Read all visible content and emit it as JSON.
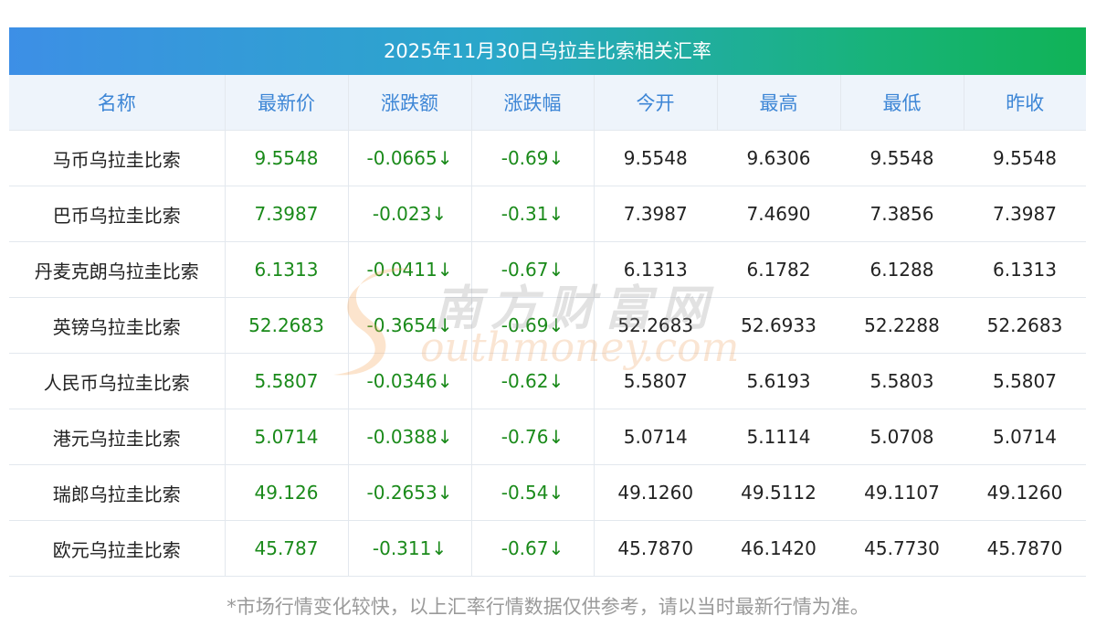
{
  "title": "2025年11月30日乌拉圭比索相关汇率",
  "headers": [
    "名称",
    "最新价",
    "涨跌额",
    "涨跌幅",
    "今开",
    "最高",
    "最低",
    "昨收"
  ],
  "rows": [
    [
      "马币乌拉圭比索",
      "9.5548",
      "-0.0665↓",
      "-0.69↓",
      "9.5548",
      "9.6306",
      "9.5548",
      "9.5548"
    ],
    [
      "巴币乌拉圭比索",
      "7.3987",
      "-0.023↓",
      "-0.31↓",
      "7.3987",
      "7.4690",
      "7.3856",
      "7.3987"
    ],
    [
      "丹麦克朗乌拉圭比索",
      "6.1313",
      "-0.0411↓",
      "-0.67↓",
      "6.1313",
      "6.1782",
      "6.1288",
      "6.1313"
    ],
    [
      "英镑乌拉圭比索",
      "52.2683",
      "-0.3654↓",
      "-0.69↓",
      "52.2683",
      "52.6933",
      "52.2288",
      "52.2683"
    ],
    [
      "人民币乌拉圭比索",
      "5.5807",
      "-0.0346↓",
      "-0.62↓",
      "5.5807",
      "5.6193",
      "5.5803",
      "5.5807"
    ],
    [
      "港元乌拉圭比索",
      "5.0714",
      "-0.0388↓",
      "-0.76↓",
      "5.0714",
      "5.1114",
      "5.0708",
      "5.0714"
    ],
    [
      "瑞郎乌拉圭比索",
      "49.126",
      "-0.2653↓",
      "-0.54↓",
      "49.1260",
      "49.5112",
      "49.1107",
      "49.1260"
    ],
    [
      "欧元乌拉圭比索",
      "45.787",
      "-0.311↓",
      "-0.67↓",
      "45.7870",
      "46.1420",
      "45.7730",
      "45.7870"
    ]
  ],
  "footnote": "*市场行情变化较快，以上汇率行情数据仅供参考，请以当时最新行情为准。",
  "watermark": {
    "cn": "南方财富网",
    "en": "outhmoney.com"
  },
  "colors": {
    "title_gradient_start": "#3d8fe6",
    "title_gradient_end": "#10b356",
    "header_text": "#3d86d6",
    "header_bg": "#eef4fb",
    "change_text": "#1a8a1a"
  }
}
